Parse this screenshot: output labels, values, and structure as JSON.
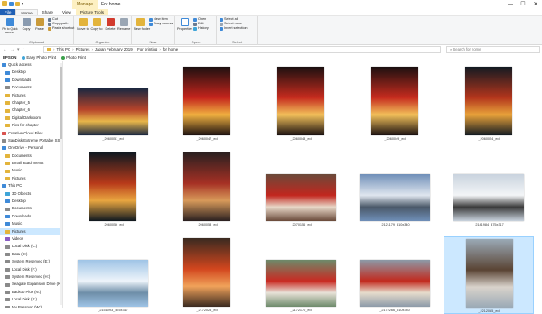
{
  "window": {
    "manage_tab": "Manage",
    "title": "For home",
    "controls": [
      "—",
      "☐",
      "✕"
    ]
  },
  "ribbon_tabs": [
    "File",
    "Home",
    "Share",
    "View",
    "Picture Tools"
  ],
  "ribbon": {
    "clipboard": {
      "pin": "Pin to Quick access",
      "copy": "Copy",
      "paste": "Paste",
      "cut": "Cut",
      "copy_path": "Copy path",
      "paste_shortcut": "Paste shortcut",
      "label": "Clipboard"
    },
    "organize": {
      "move_to": "Move to",
      "copy_to": "Copy to",
      "delete": "Delete",
      "rename": "Rename",
      "label": "Organize"
    },
    "new": {
      "new_folder": "New folder",
      "new_item": "New item",
      "easy_access": "Easy access",
      "label": "New"
    },
    "open": {
      "properties": "Properties",
      "open": "Open",
      "edit": "Edit",
      "history": "History",
      "label": "Open"
    },
    "select": {
      "select_all": "Select all",
      "select_none": "Select none",
      "invert": "Invert selection",
      "label": "Select"
    }
  },
  "address": {
    "crumbs": [
      "This PC",
      "Pictures",
      "Japan February 2019",
      "For printing",
      "for home"
    ],
    "search_placeholder": "Search for home"
  },
  "favorites": [
    "EPSON",
    "Easy Photo Print",
    "Photo Print"
  ],
  "nav_items": [
    {
      "label": "Quick access",
      "indent": 0,
      "color": "#3f8ad8"
    },
    {
      "label": "Desktop",
      "indent": 1,
      "color": "#3f8ad8"
    },
    {
      "label": "Downloads",
      "indent": 1,
      "color": "#3f8ad8"
    },
    {
      "label": "Documents",
      "indent": 1,
      "color": "#8a8a8a"
    },
    {
      "label": "Pictures",
      "indent": 1,
      "color": "#e3b43c"
    },
    {
      "label": "Chapter_5",
      "indent": 1,
      "color": "#e3b43c"
    },
    {
      "label": "Chapter_6",
      "indent": 1,
      "color": "#e3b43c"
    },
    {
      "label": "Digital Darkroom",
      "indent": 1,
      "color": "#e3b43c"
    },
    {
      "label": "Pics for chapter",
      "indent": 1,
      "color": "#e3b43c"
    },
    {
      "label": "Creative Cloud Files",
      "indent": 0,
      "color": "#d9534f"
    },
    {
      "label": "SanDisk Extreme Portable SSD",
      "indent": 0,
      "color": "#8a8a8a"
    },
    {
      "label": "OneDrive - Personal",
      "indent": 0,
      "color": "#3f8ad8"
    },
    {
      "label": "Documents",
      "indent": 1,
      "color": "#e3b43c"
    },
    {
      "label": "Email attachments",
      "indent": 1,
      "color": "#e3b43c"
    },
    {
      "label": "Music",
      "indent": 1,
      "color": "#e3b43c"
    },
    {
      "label": "Pictures",
      "indent": 1,
      "color": "#e3b43c"
    },
    {
      "label": "This PC",
      "indent": 0,
      "color": "#3f8ad8"
    },
    {
      "label": "3D Objects",
      "indent": 1,
      "color": "#3fa5d8"
    },
    {
      "label": "Desktop",
      "indent": 1,
      "color": "#3f8ad8"
    },
    {
      "label": "Documents",
      "indent": 1,
      "color": "#8a8a8a"
    },
    {
      "label": "Downloads",
      "indent": 1,
      "color": "#3f8ad8"
    },
    {
      "label": "Music",
      "indent": 1,
      "color": "#3f8ad8"
    },
    {
      "label": "Pictures",
      "indent": 1,
      "color": "#e3b43c",
      "selected": true
    },
    {
      "label": "Videos",
      "indent": 1,
      "color": "#8a5cc4"
    },
    {
      "label": "Local Disk (C:)",
      "indent": 1,
      "color": "#8a8a8a"
    },
    {
      "label": "Data (D:)",
      "indent": 1,
      "color": "#8a8a8a"
    },
    {
      "label": "System Reserved (E:)",
      "indent": 1,
      "color": "#8a8a8a"
    },
    {
      "label": "Local Disk (F:)",
      "indent": 1,
      "color": "#8a8a8a"
    },
    {
      "label": "System Reserved (H:)",
      "indent": 1,
      "color": "#8a8a8a"
    },
    {
      "label": "Seagate Expansion Drive (K:)",
      "indent": 1,
      "color": "#8a8a8a"
    },
    {
      "label": "Backup Plus (N:)",
      "indent": 1,
      "color": "#8a8a8a"
    },
    {
      "label": "Local Disk (S:)",
      "indent": 1,
      "color": "#8a8a8a"
    },
    {
      "label": "My Passport (W:)",
      "indent": 1,
      "color": "#8a8a8a"
    },
    {
      "label": "Elements (X:)",
      "indent": 1,
      "color": "#8a8a8a"
    }
  ],
  "files": [
    {
      "name": "_2060051_ed",
      "orient": "land",
      "colors": [
        "#1a2740",
        "#b5432a",
        "#e8b64a"
      ]
    },
    {
      "name": "_2060047_ed",
      "orient": "port",
      "colors": [
        "#1c1010",
        "#c4241c",
        "#f0b040"
      ]
    },
    {
      "name": "_2060048_ed",
      "orient": "port",
      "colors": [
        "#1a1010",
        "#c62b1e",
        "#f2c05a"
      ]
    },
    {
      "name": "_2060049_ed",
      "orient": "port",
      "colors": [
        "#1a1010",
        "#c62b1e",
        "#f2c05a"
      ]
    },
    {
      "name": "_2060054_ed",
      "orient": "port",
      "colors": [
        "#121a22",
        "#b3351c",
        "#e8a23a"
      ]
    },
    {
      "name": "_2060056_ed",
      "orient": "port",
      "colors": [
        "#0f1820",
        "#b83a1a",
        "#e9a640"
      ]
    },
    {
      "name": "_2060058_ed",
      "orient": "port",
      "colors": [
        "#2a2020",
        "#a63024",
        "#d89a5a"
      ]
    },
    {
      "name": "_2070156_ed",
      "orient": "land",
      "colors": [
        "#6a4a3a",
        "#c2261e",
        "#e8d8c8"
      ]
    },
    {
      "name": "_2121179_510x340",
      "orient": "land",
      "colors": [
        "#6f8fb8",
        "#dfe6ef",
        "#4a5868"
      ]
    },
    {
      "name": "_2141984_475x317",
      "orient": "land",
      "colors": [
        "#c9d3de",
        "#f3f5f7",
        "#3a3a3a"
      ]
    },
    {
      "name": "_2151093_475x317",
      "orient": "land",
      "colors": [
        "#9fc4e6",
        "#eef4fa",
        "#6e8ea8"
      ]
    },
    {
      "name": "_2172025_ed",
      "orient": "port",
      "colors": [
        "#3a2a20",
        "#d2461e",
        "#f0a25a"
      ]
    },
    {
      "name": "_2172170_ed",
      "orient": "land",
      "colors": [
        "#6d8a6a",
        "#c92a22",
        "#e8e2d8"
      ]
    },
    {
      "name": "_2172266_510x340",
      "orient": "land",
      "colors": [
        "#8c9aa8",
        "#c22a1e",
        "#e7dccc"
      ]
    },
    {
      "name": "_2212085_ed",
      "orient": "port",
      "colors": [
        "#9aa9b6",
        "#5a4434",
        "#d9d3cb"
      ],
      "selected": true
    }
  ]
}
